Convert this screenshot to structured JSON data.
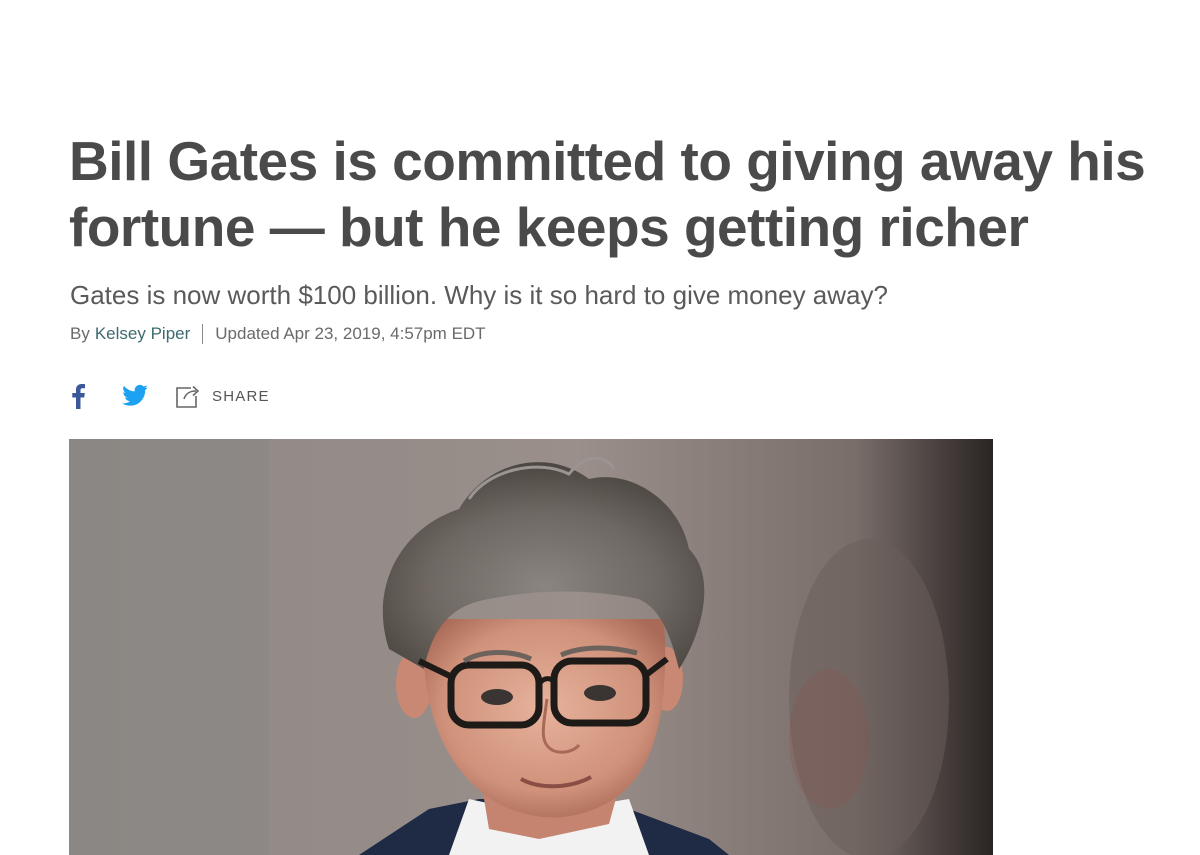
{
  "article": {
    "headline": "Bill Gates is committed to giving away his fortune — but he keeps getting richer",
    "dek": "Gates is now worth $100 billion. Why is it so hard to give money away?",
    "byline": {
      "prefix": "By",
      "author": "Kelsey Piper",
      "updated": "Updated Apr 23, 2019, 4:57pm EDT"
    }
  },
  "share": {
    "facebook_icon": "facebook-icon",
    "twitter_icon": "twitter-icon",
    "share_icon": "share-icon",
    "share_label": "SHARE"
  },
  "colors": {
    "headline": "#4a4a4a",
    "author_link": "#3e6a6e",
    "facebook": "#3b5998",
    "twitter": "#1da1f2"
  },
  "hero": {
    "icon": "portrait-photo"
  }
}
